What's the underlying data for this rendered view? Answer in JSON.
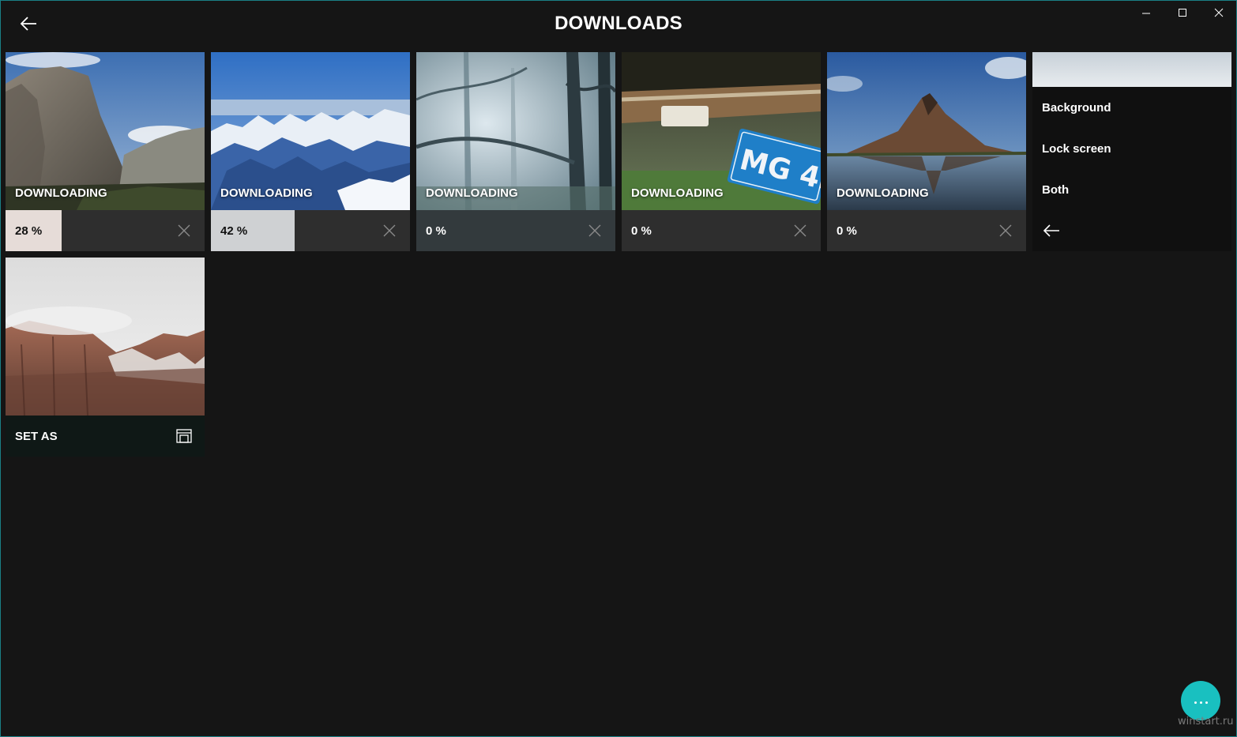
{
  "header": {
    "title": "DOWNLOADS",
    "back_icon": "arrow-left-icon"
  },
  "window_controls": {
    "minimize_icon": "minimize-icon",
    "maximize_icon": "maximize-icon",
    "close_icon": "close-icon"
  },
  "downloads": [
    {
      "status": "DOWNLOADING",
      "progress_label": "28 %",
      "progress": 0.28,
      "scene": "granite cliff valley",
      "fill_color": "#e6dcd8"
    },
    {
      "status": "DOWNLOADING",
      "progress_label": "42 %",
      "progress": 0.42,
      "scene": "snowy mountain range aerial",
      "fill_color": "#cfd1d3"
    },
    {
      "status": "DOWNLOADING",
      "progress_label": "0 %",
      "progress": 0,
      "scene": "misty forest"
    },
    {
      "status": "DOWNLOADING",
      "progress_label": "0 %",
      "progress": 0,
      "scene": "license plate on car bumper"
    },
    {
      "status": "DOWNLOADING",
      "progress_label": "0 %",
      "progress": 0,
      "scene": "mountain by a lake"
    }
  ],
  "set_as_menu": {
    "items": [
      "Background",
      "Lock screen",
      "Both"
    ],
    "back_icon": "arrow-left-icon"
  },
  "completed": {
    "label": "SET AS",
    "icon": "set-as-icon",
    "scene": "red rock cliffs with snow"
  },
  "fab": {
    "icon": "more-dots-icon",
    "color": "#19c0c0"
  },
  "watermark": "winstart.ru",
  "colors": {
    "background": "#151515",
    "accent": "#19c0c0",
    "frame": "#1a7f86"
  }
}
